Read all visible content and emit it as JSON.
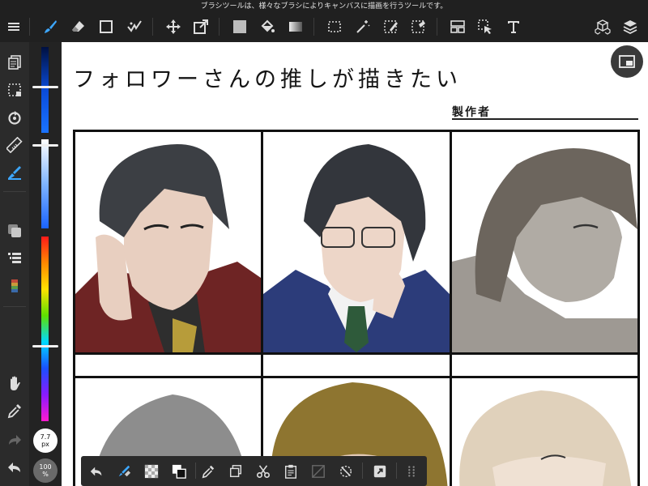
{
  "status_hint": "ブラシツールは、様々なブラシによりキャンバスに描画を行うツールです。",
  "canvas": {
    "title": "フォロワーさんの推しが描きたい",
    "creator_label": "製作者"
  },
  "brush": {
    "size_value": "7.7",
    "size_unit": "px",
    "opacity_value": "100",
    "opacity_unit": "%"
  },
  "toolbar_icons": [
    "menu-icon",
    "brush-icon",
    "eraser-icon",
    "rectangle-icon",
    "smudge-icon",
    "move-icon",
    "transform-icon",
    "fill-color-icon",
    "bucket-icon",
    "gradient-icon",
    "select-icon",
    "magic-wand-icon",
    "select-pen-icon",
    "select-eraser-icon",
    "panel-icon",
    "operation-icon",
    "text-icon",
    "3d-icon",
    "layers-icon"
  ],
  "colors": {
    "accent": "#3da7ff",
    "toolbar_bg": "#202020",
    "sidebar_bg": "#2b2b2b",
    "hair_dark": "#3c3f44",
    "hair_brown": "#6c655d",
    "hair_gold": "#8e7530",
    "hair_silver": "#8d8d8d",
    "hair_blond": "#e0d1bb"
  }
}
